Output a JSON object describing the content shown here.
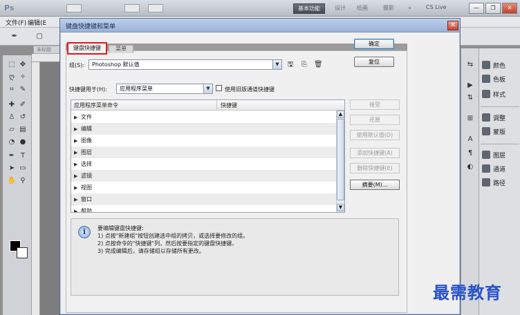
{
  "app": {
    "logo": "Ps",
    "workspace_buttons": [
      "基本功能",
      "设计",
      "绘画",
      "摄影",
      "»"
    ],
    "cslive": "CS Live",
    "menus": [
      "文件(F)",
      "编辑(E"
    ],
    "doc_tab": "未标题"
  },
  "panels": {
    "items": [
      "颜色",
      "色板",
      "样式",
      "调整",
      "蒙版",
      "图层",
      "通道",
      "路径"
    ]
  },
  "dialog": {
    "title": "键盘快捷键和菜单",
    "close_glyph": "✕",
    "tabs": [
      {
        "label": "键盘快捷键",
        "active": true
      },
      {
        "label": "菜单",
        "active": false
      }
    ],
    "set": {
      "label": "组(S):",
      "value": "Photoshop 默认值"
    },
    "shortcuts_for": {
      "label": "快捷键用于(H):",
      "value": "应用程序菜单"
    },
    "legacy_checkbox": {
      "label": "使用旧版通道快捷键",
      "checked": false
    },
    "table": {
      "columns": [
        "应用程序菜单命令",
        "快捷键"
      ],
      "rows": [
        "文件",
        "编辑",
        "图像",
        "图层",
        "选择",
        "滤镜",
        "视图",
        "窗口",
        "帮助"
      ]
    },
    "side_buttons": [
      {
        "label": "接受",
        "enabled": false
      },
      {
        "label": "还原",
        "enabled": false
      },
      {
        "label": "使用默认值(D)",
        "enabled": false
      },
      {
        "label": "添加快捷键(A)",
        "enabled": false
      },
      {
        "label": "删除快捷键(E)",
        "enabled": false
      },
      {
        "label": "摘要(M)...",
        "enabled": true
      }
    ],
    "info": {
      "heading": "要编辑键盘快捷键:",
      "lines": [
        "1) 点按\"新建组\"按钮创建选中组的拷贝，或选择要修改的组。",
        "2) 点按命令的\"快捷键\"列，然后按要指定的键盘快捷键。",
        "3) 完成编辑后，请存储组以存储所有更改。"
      ]
    },
    "ok_label": "确定",
    "reset_label": "复位"
  },
  "watermark": "最需教育"
}
